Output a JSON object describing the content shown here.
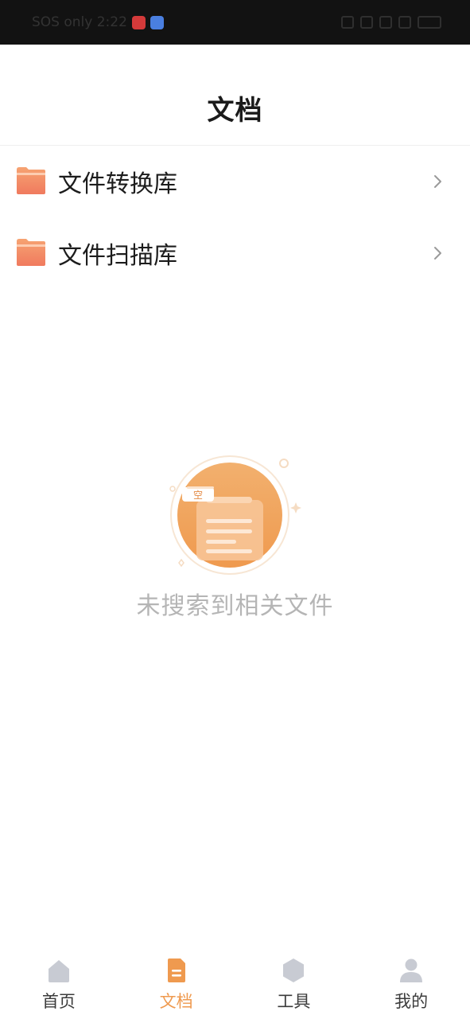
{
  "status_bar": {
    "text": "SOS only 2:22"
  },
  "header": {
    "title": "文档"
  },
  "folders": [
    {
      "label": "文件转换库",
      "icon": "folder-icon"
    },
    {
      "label": "文件扫描库",
      "icon": "folder-icon"
    }
  ],
  "empty_state": {
    "badge": "空",
    "message": "未搜索到相关文件"
  },
  "bottom_nav": {
    "items": [
      {
        "label": "首页",
        "icon": "home-icon",
        "active": false
      },
      {
        "label": "文档",
        "icon": "document-icon",
        "active": true
      },
      {
        "label": "工具",
        "icon": "hexagon-icon",
        "active": false
      },
      {
        "label": "我的",
        "icon": "user-icon",
        "active": false
      }
    ]
  },
  "colors": {
    "accent": "#ef9a4f",
    "folder_top": "#f7a070",
    "folder_bottom": "#f07a5e",
    "inactive_icon": "#c8cbd3"
  }
}
